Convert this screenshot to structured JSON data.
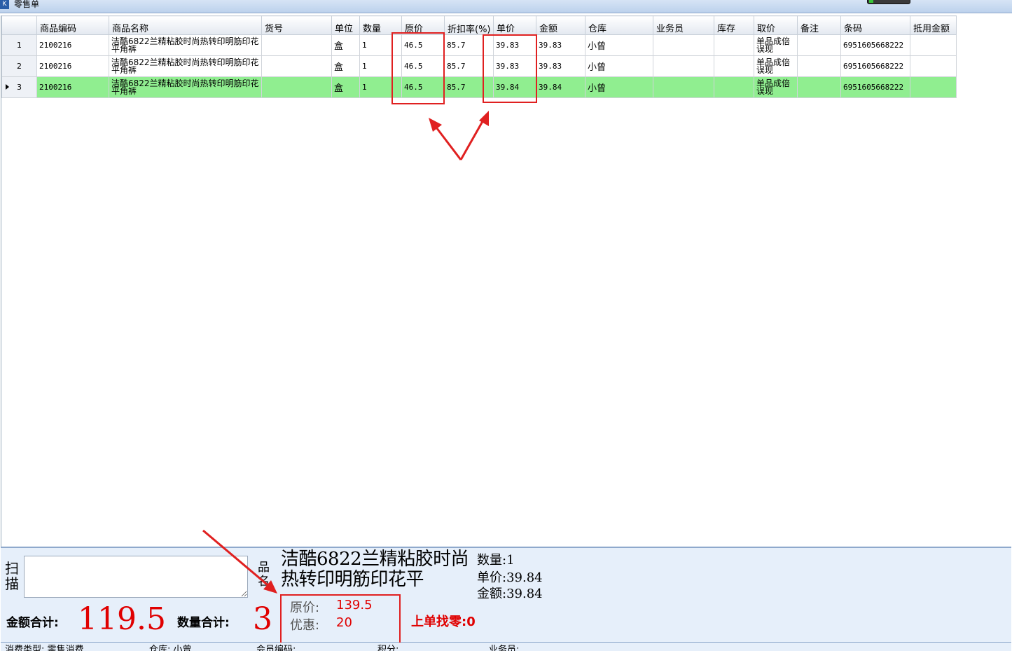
{
  "window": {
    "title": "零售单"
  },
  "grid": {
    "columns": [
      "",
      "商品编码",
      "商品名称",
      "货号",
      "单位",
      "数量",
      "原价",
      "折扣率(%)",
      "单价",
      "金额",
      "仓库",
      "业务员",
      "库存",
      "取价",
      "备注",
      "条码",
      "抵用金额"
    ],
    "rows": [
      {
        "idx": "1",
        "code": "2100216",
        "name": "洁酷6822兰精粘胶时尚热转印明筋印花平角裤",
        "sku": "",
        "unit": "盒",
        "qty": "1",
        "orig_price": "46.5",
        "discount": "85.7",
        "unit_price": "39.83",
        "amount": "39.83",
        "warehouse": "小曾",
        "salesman": "",
        "stock": "",
        "pricing": "单品成倍误现",
        "note": "",
        "barcode": "6951605668222",
        "offset": ""
      },
      {
        "idx": "2",
        "code": "2100216",
        "name": "洁酷6822兰精粘胶时尚热转印明筋印花平角裤",
        "sku": "",
        "unit": "盒",
        "qty": "1",
        "orig_price": "46.5",
        "discount": "85.7",
        "unit_price": "39.83",
        "amount": "39.83",
        "warehouse": "小曾",
        "salesman": "",
        "stock": "",
        "pricing": "单品成倍误现",
        "note": "",
        "barcode": "6951605668222",
        "offset": ""
      },
      {
        "idx": "3",
        "code": "2100216",
        "name": "洁酷6822兰精粘胶时尚热转印明筋印花平角裤",
        "sku": "",
        "unit": "盒",
        "qty": "1",
        "orig_price": "46.5",
        "discount": "85.7",
        "unit_price": "39.84",
        "amount": "39.84",
        "warehouse": "小曾",
        "salesman": "",
        "stock": "",
        "pricing": "单品成倍误现",
        "note": "",
        "barcode": "6951605668222",
        "offset": ""
      }
    ],
    "selected_row": 3
  },
  "scan": {
    "label": "扫描",
    "value": ""
  },
  "product": {
    "name_label": "品名",
    "name": "洁酷6822兰精粘胶时尚热转印明筋印花平",
    "qty_label": "数量:",
    "qty": "1",
    "price_label": "单价:",
    "price": "39.84",
    "amount_label": "金额:",
    "amount": "39.84"
  },
  "totals": {
    "amount_label": "金额合计:",
    "amount": "119.5",
    "qty_label": "数量合计:",
    "qty": "3",
    "orig_label": "原价:",
    "orig": "139.5",
    "discount_label": "优惠:",
    "discount": "20",
    "change_label": "上单找零:",
    "change": "0"
  },
  "status": {
    "type": "消费类型: 零售消费",
    "warehouse": "仓库: 小曾",
    "member": "会员编码:",
    "points": "积分:",
    "salesman": "业务员:"
  },
  "colors": {
    "selected_row": "#90ee90",
    "highlight": "#e02020",
    "total_red": "#e00000",
    "panel_bg": "#e6effa"
  }
}
